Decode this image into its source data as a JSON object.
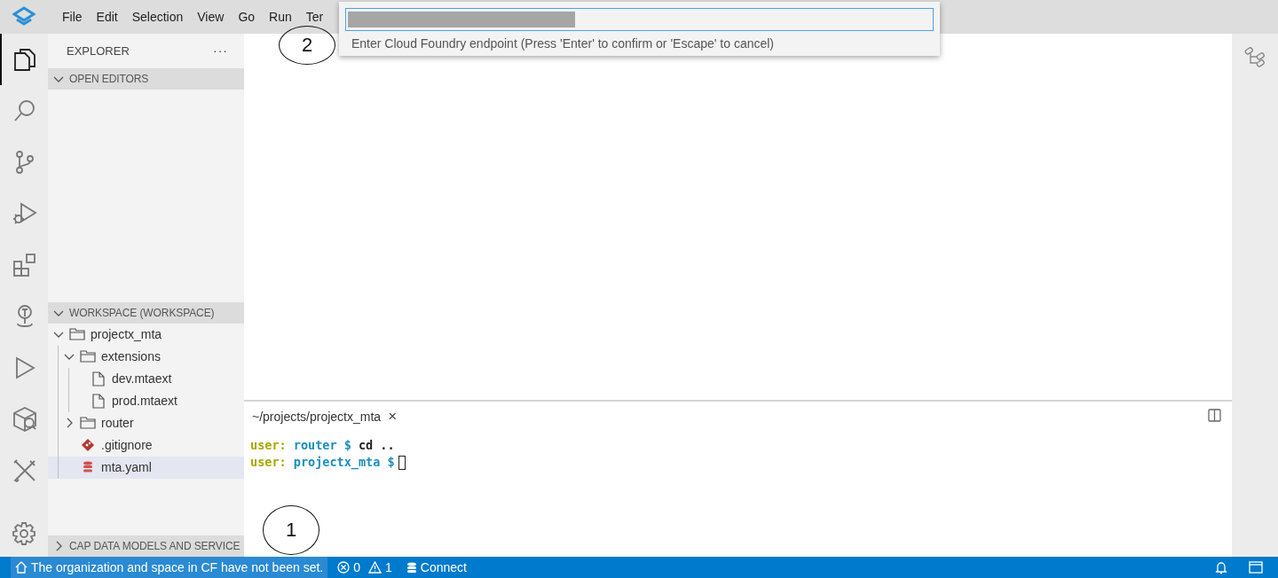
{
  "menu": [
    {
      "label": "File"
    },
    {
      "label": "Edit"
    },
    {
      "label": "Selection"
    },
    {
      "label": "View"
    },
    {
      "label": "Go"
    },
    {
      "label": "Run"
    },
    {
      "label": "Ter"
    }
  ],
  "quick_input": {
    "message": "Enter Cloud Foundry endpoint (Press 'Enter' to confirm or 'Escape' to cancel)"
  },
  "activity_bar": [
    {
      "kind": "files",
      "selected": true
    },
    {
      "kind": "search",
      "selected": false
    },
    {
      "kind": "scm",
      "selected": false
    },
    {
      "kind": "debug",
      "selected": false
    },
    {
      "kind": "extensions",
      "selected": false
    },
    {
      "kind": "pin",
      "selected": false
    },
    {
      "kind": "run",
      "selected": false
    },
    {
      "kind": "cube",
      "selected": false
    },
    {
      "kind": "tools",
      "selected": false
    }
  ],
  "sidebar": {
    "title": "EXPLORER",
    "more": "···",
    "sections": [
      {
        "title": "OPEN EDITORS",
        "expanded": true
      },
      {
        "title": "WORKSPACE (WORKSPACE)",
        "expanded": true,
        "tree": [
          {
            "label": "projectx_mta",
            "kind": "folder",
            "expanded": true,
            "selected": false,
            "children": [
              {
                "label": "extensions",
                "kind": "folder",
                "expanded": true,
                "selected": false,
                "children": [
                  {
                    "label": "dev.mtaext",
                    "kind": "file",
                    "selected": false
                  },
                  {
                    "label": "prod.mtaext",
                    "kind": "file",
                    "selected": false
                  }
                ]
              },
              {
                "label": "router",
                "kind": "folder",
                "expanded": false,
                "selected": false
              },
              {
                "label": ".gitignore",
                "kind": "git",
                "selected": false
              },
              {
                "label": "mta.yaml",
                "kind": "yaml",
                "selected": true
              }
            ]
          }
        ]
      },
      {
        "title": "CAP DATA MODELS AND SERVICE",
        "expanded": false
      }
    ]
  },
  "terminal": {
    "tab": "~/projects/projectx_mta",
    "close": "×",
    "lines": [
      {
        "user": "user:",
        "path": "router $",
        "command": "cd ..",
        "cursor": false
      },
      {
        "user": "user:",
        "path": "projectx_mta $",
        "cursor": true
      }
    ]
  },
  "status_bar": {
    "message": "The organization and space in CF have not been set.",
    "errors": "0",
    "warnings": "1",
    "connect": "Connect"
  },
  "annotations": [
    {
      "label": "2"
    },
    {
      "label": "1"
    }
  ]
}
